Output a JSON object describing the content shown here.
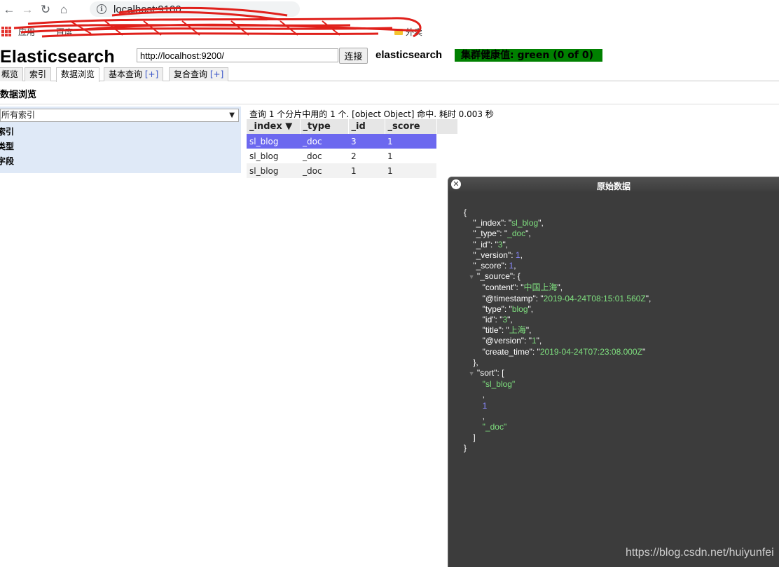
{
  "browser": {
    "url": "localhost:9100",
    "bookmarks": [
      "应用",
      "百度",
      "外卖"
    ]
  },
  "header": {
    "title": "Elasticsearch",
    "connect_url": "http://localhost:9200/",
    "connect_label": "连接",
    "cluster_name": "elasticsearch",
    "health": "集群健康值: green (0 of 0)",
    "health_color": "#008000"
  },
  "tabs": [
    {
      "label": "概览",
      "plus": ""
    },
    {
      "label": "索引",
      "plus": ""
    },
    {
      "label": "数据浏览",
      "plus": ""
    },
    {
      "label": "基本查询 ",
      "plus": "[+]"
    },
    {
      "label": "复合查询 ",
      "plus": "[+]"
    }
  ],
  "section_title": "数据浏览",
  "filter": {
    "index_select": "所有索引",
    "items": [
      "索引",
      "类型",
      "字段"
    ]
  },
  "results": {
    "info": "查询 1 个分片中用的 1 个. [object Object] 命中. 耗时 0.003 秒",
    "columns": [
      "_index ▼",
      "_type",
      "_id",
      "_score"
    ],
    "rows": [
      [
        "sl_blog",
        "_doc",
        "3",
        "1"
      ],
      [
        "sl_blog",
        "_doc",
        "2",
        "1"
      ],
      [
        "sl_blog",
        "_doc",
        "1",
        "1"
      ]
    ]
  },
  "dialog": {
    "title": "原始数据",
    "doc": {
      "_index": "sl_blog",
      "_type": "_doc",
      "_id": "3",
      "_version": "1",
      "_score": "1",
      "content": "中国上海",
      "timestamp": "2019-04-24T08:15:01.560Z",
      "type": "blog",
      "id": "3",
      "title": "上海",
      "version": "1",
      "create_time": "2019-04-24T07:23:08.000Z",
      "sort_0": "sl_blog",
      "sort_1": "1",
      "sort_2": "_doc"
    }
  },
  "watermark": "https://blog.csdn.net/huiyunfei",
  "colors": {
    "selected_row": "#6c68ef",
    "filter_panel": "#dfe9f7",
    "dialog_bg": "#3c3c3c",
    "json_string": "#7fe07f",
    "json_number": "#8a8aff"
  }
}
